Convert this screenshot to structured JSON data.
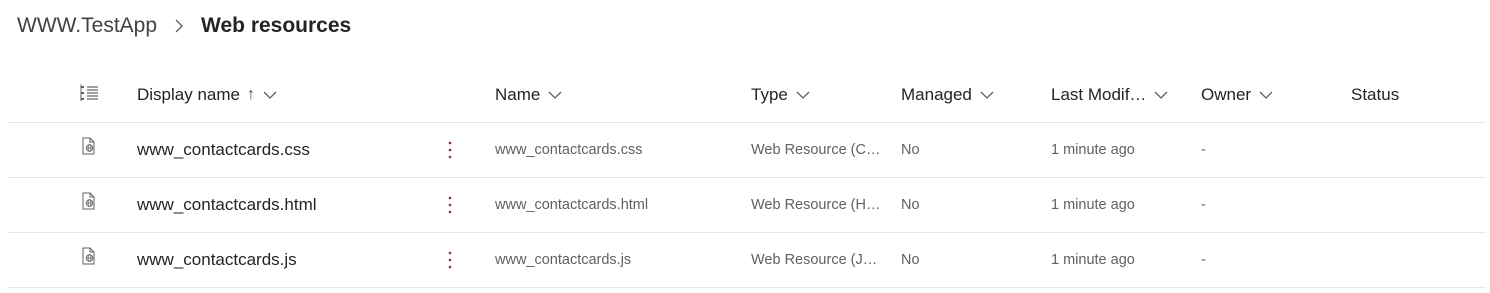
{
  "breadcrumb": {
    "root": "WWW.TestApp",
    "current": "Web resources"
  },
  "columns": {
    "display_name": "Display name",
    "display_name_sort": "↑",
    "name": "Name",
    "type": "Type",
    "managed": "Managed",
    "last_modified": "Last Modif…",
    "owner": "Owner",
    "status": "Status"
  },
  "rows": [
    {
      "display_name": "www_contactcards.css",
      "name": "www_contactcards.css",
      "type": "Web Resource (C…",
      "managed": "No",
      "last_modified": "1 minute ago",
      "owner": "-",
      "status": ""
    },
    {
      "display_name": "www_contactcards.html",
      "name": "www_contactcards.html",
      "type": "Web Resource (H…",
      "managed": "No",
      "last_modified": "1 minute ago",
      "owner": "-",
      "status": ""
    },
    {
      "display_name": "www_contactcards.js",
      "name": "www_contactcards.js",
      "type": "Web Resource (J…",
      "managed": "No",
      "last_modified": "1 minute ago",
      "owner": "-",
      "status": ""
    }
  ],
  "icons": {
    "row_icon": "web-resource-file-icon",
    "header_icon": "column-options-icon",
    "more_icon": "more-vertical-icon",
    "chevron": "chevron-down-icon",
    "separator": "chevron-right-icon"
  },
  "colors": {
    "accent": "#742774",
    "divider": "#e6e6e6",
    "secondary_text": "#616161"
  }
}
